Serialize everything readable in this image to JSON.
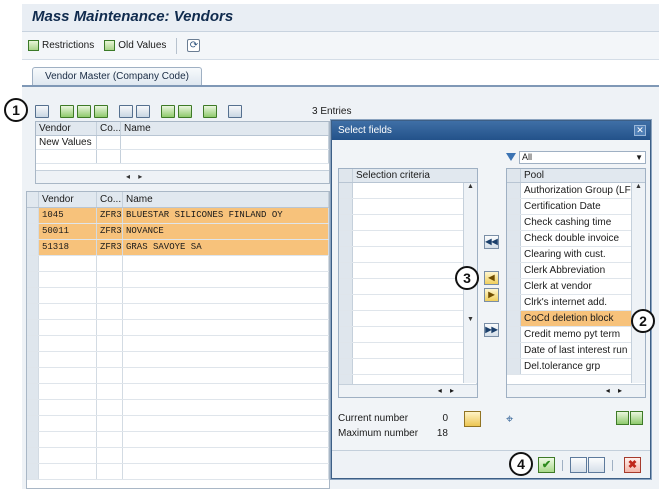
{
  "window": {
    "title": "Mass Maintenance: Vendors"
  },
  "toolbar": {
    "restrictions_label": "Restrictions",
    "old_values_label": "Old Values"
  },
  "tabs": [
    {
      "label": "Vendor Master (Company Code)"
    }
  ],
  "markers": [
    "1",
    "2",
    "3",
    "4"
  ],
  "grid_toolbar": {
    "entries_label": "3 Entries"
  },
  "new_values_table": {
    "columns": [
      "Vendor",
      "Co...",
      "Name"
    ],
    "row_label": "New Values"
  },
  "vendor_table": {
    "columns": [
      "Vendor",
      "Co...",
      "Name"
    ],
    "rows": [
      {
        "vendor": "1045",
        "company": "ZFR3",
        "name": "BLUESTAR SILICONES FINLAND OY"
      },
      {
        "vendor": "50011",
        "company": "ZFR3",
        "name": "NOVANCE"
      },
      {
        "vendor": "51318",
        "company": "ZFR3",
        "name": "GRAS SAVOYE SA"
      }
    ]
  },
  "dialog": {
    "title": "Select fields",
    "left_panel": {
      "header": "Selection criteria"
    },
    "filter": {
      "value": "All"
    },
    "pool": {
      "header": "Pool",
      "items": [
        "Authorization Group (LFB",
        "Certification Date",
        "Check cashing time",
        "Check double invoice",
        "Clearing with cust.",
        "Clerk Abbreviation",
        "Clerk at vendor",
        "Clrk's internet add.",
        "CoCd deletion block",
        "Credit memo pyt term",
        "Date of last interest run",
        "Del.tolerance grp"
      ],
      "highlighted_index": 8
    },
    "counts": {
      "current_label": "Current number",
      "current_value": "0",
      "maximum_label": "Maximum number",
      "maximum_value": "18"
    }
  },
  "colors": {
    "highlight": "#f7c27b",
    "dialog_title": "#23528a",
    "app_title": "#102b4e"
  }
}
